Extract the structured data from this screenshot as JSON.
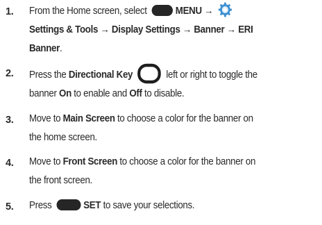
{
  "steps": [
    {
      "num": "1.",
      "line1_a": "From the Home screen, select",
      "line1_menu": "MENU",
      "arrow": "→",
      "line2_a": "Settings & Tools",
      "line2_b": "Display Settings",
      "line2_c": "Banner",
      "line2_d": "ERI",
      "line3_a": "Banner",
      "line3_end": "."
    },
    {
      "num": "2.",
      "line1_a": "Press the",
      "line1_key": "Directional Key",
      "line1_b": "left or right to toggle the",
      "line2_a": "banner",
      "line2_on": "On",
      "line2_b": "to enable and",
      "line2_off": "Off",
      "line2_c": "to disable."
    },
    {
      "num": "3.",
      "line1_a": "Move to",
      "line1_b": "Main Screen",
      "line1_c": "to choose a color for the banner on",
      "line2": "the home screen."
    },
    {
      "num": "4.",
      "line1_a": "Move to",
      "line1_b": "Front Screen",
      "line1_c": "to choose a color for the banner on",
      "line2": "the front screen."
    },
    {
      "num": "5.",
      "line1_a": "Press",
      "line1_set": "SET",
      "line1_b": "to save your selections."
    }
  ],
  "icons": {
    "softkey": "left-softkey-icon",
    "settings": "settings-gear-icon",
    "directional": "directional-key-icon"
  },
  "colors": {
    "text": "#2a2a2a",
    "softkey": "#262626",
    "gear_blue": "#3d8fd1"
  }
}
